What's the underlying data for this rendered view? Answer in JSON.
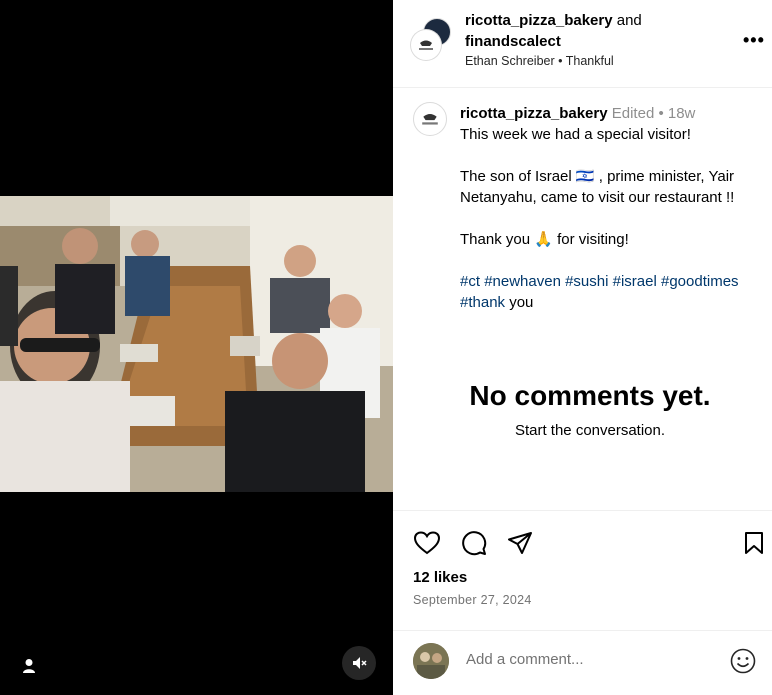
{
  "header": {
    "user1": "ricotta_pizza_bakery",
    "conjunction": "and",
    "user2": "finandscalect",
    "subline": "Ethan Schreiber • Thankful",
    "more_icon": "more-horizontal-icon"
  },
  "caption": {
    "username": "ricotta_pizza_bakery",
    "meta": "Edited • 18w",
    "line1": "This week we had a special visitor!",
    "line2": "The son of Israel 🇮🇱 , prime minister, Yair Netanyahu, came to visit our restaurant !!",
    "line3_before": "Thank you",
    "line3_emoji": "🙏",
    "line3_after": "for visiting!",
    "hashtags": [
      "#ct",
      "#newhaven",
      "#sushi",
      "#israel",
      "#goodtimes",
      "#thank"
    ],
    "hashtag_tail": "you"
  },
  "comments": {
    "empty_title": "No comments yet.",
    "empty_sub": "Start the conversation."
  },
  "actions": {
    "likes": "12 likes",
    "date": "September 27, 2024",
    "icons": [
      "heart-icon",
      "comment-icon",
      "share-icon",
      "bookmark-icon"
    ]
  },
  "comment_bar": {
    "placeholder": "Add a comment...",
    "emoji_icon": "smiley-icon"
  },
  "media": {
    "user_tag_icon": "person-icon",
    "mute_icon": "speaker-muted-icon"
  },
  "colors": {
    "hashtag": "#00376b",
    "muted_text": "#737373",
    "media_bg": "#000000"
  }
}
